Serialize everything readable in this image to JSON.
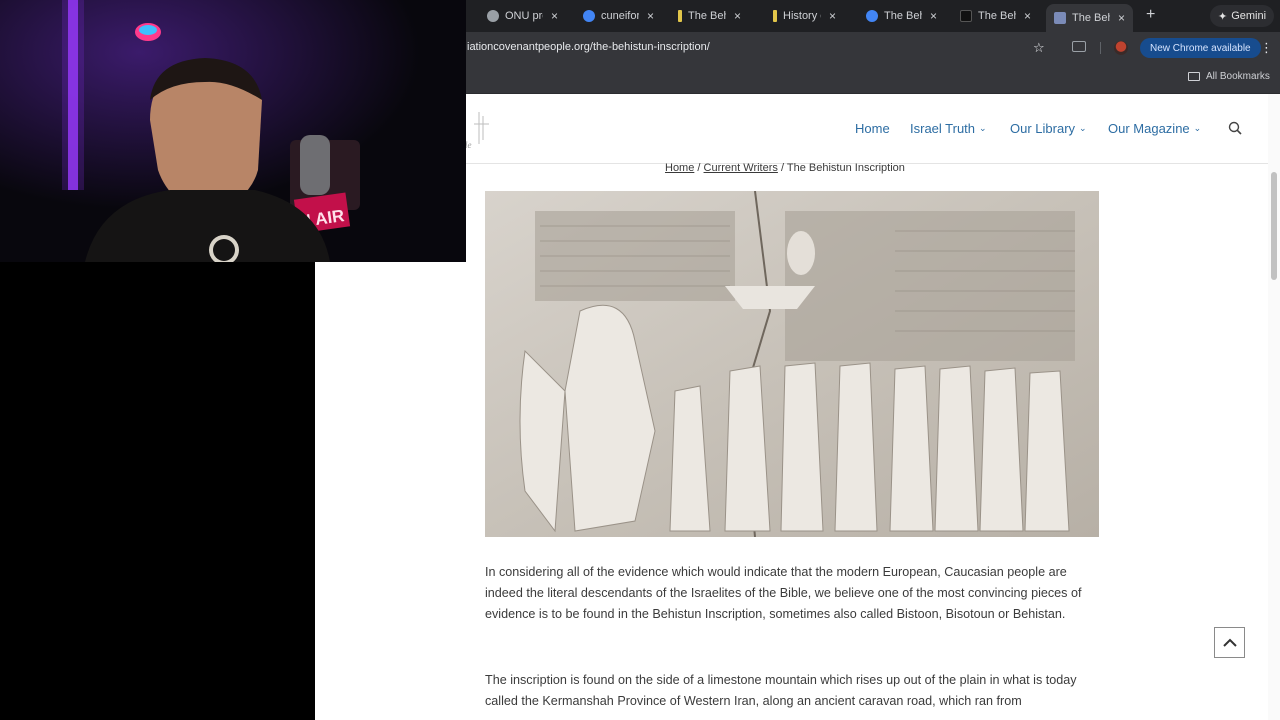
{
  "browser": {
    "tabs": [
      {
        "title": "ONU pro",
        "favicon_color": "#9aa0a6"
      },
      {
        "title": "cuneiforn",
        "favicon_color": "#4285f4"
      },
      {
        "title": "The Behi",
        "favicon_color": "#e2c64a"
      },
      {
        "title": "History o",
        "favicon_color": "#e2c64a"
      },
      {
        "title": "The Beh",
        "favicon_color": "#4285f4"
      },
      {
        "title": "The Beh",
        "favicon_color": "#111111"
      },
      {
        "title": "The Beh",
        "favicon_color": "#7b8bb8",
        "active": true
      }
    ],
    "close_glyph": "×",
    "new_tab_glyph": "+",
    "gemini_label": "Gemini",
    "url": "iationcovenantpeople.org/the-behistun-inscription/",
    "update_label": "New Chrome available",
    "all_bookmarks": "All Bookmarks"
  },
  "site": {
    "nav": [
      {
        "label": "Home",
        "dropdown": false
      },
      {
        "label": "Israel Truth",
        "dropdown": true
      },
      {
        "label": "Our Library",
        "dropdown": true
      },
      {
        "label": "Our Magazine",
        "dropdown": true
      }
    ],
    "logo_letter": "le",
    "breadcrumb": {
      "home": "Home",
      "current_writers": "Current Writers",
      "page": "The Behistun Inscription",
      "separator": "/"
    },
    "paragraphs": [
      "In considering all of the evidence which would indicate that the modern European, Caucasian people are indeed the literal descendants of the Israelites of the Bible, we believe one of the most convincing pieces of evidence is to be found in the Behistun Inscription, sometimes also called Bistoon, Bisotoun or Behistan.",
      "The inscription is found on the side of a limestone mountain which rises up out of the plain in what is today called the Kermanshah Province of Western Iran, along an ancient caravan road, which ran from"
    ]
  },
  "webcam": {
    "sign_text": "N AIR"
  },
  "colors": {
    "link_blue": "#2d6da3",
    "chrome_dark": "#35363a",
    "update_pill": "#174c8e"
  }
}
